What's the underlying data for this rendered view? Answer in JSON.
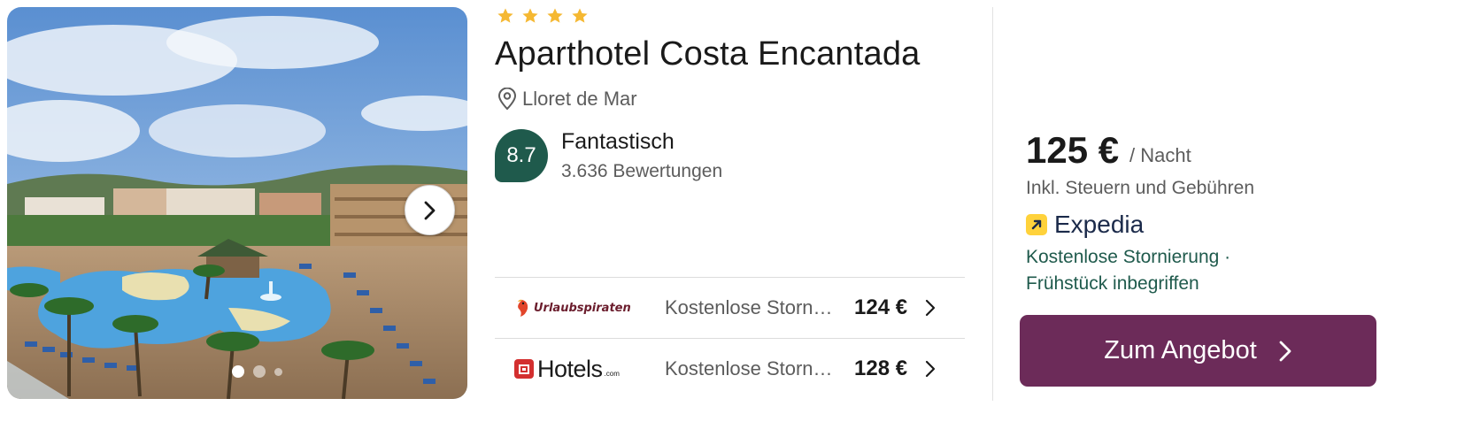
{
  "hotel": {
    "star_count": 4,
    "name": "Aparthotel Costa Encantada",
    "location": "Lloret de Mar",
    "rating": {
      "score": "8.7",
      "label": "Fantastisch",
      "reviews": "3.636 Bewertungen"
    }
  },
  "gallery": {
    "slide_count": 3,
    "active_slide": 1
  },
  "offers": [
    {
      "provider": "Urlaubspiraten",
      "cancellation": "Kostenlose Storn…",
      "price": "124 €"
    },
    {
      "provider": "Hotels",
      "provider_suffix": ".com",
      "cancellation": "Kostenlose Storn…",
      "price": "128 €"
    }
  ],
  "best_offer": {
    "price": "125 €",
    "unit": "/ Nacht",
    "note": "Inkl. Steuern und Gebühren",
    "provider": "Expedia",
    "perks_line1": "Kostenlose Stornierung ·",
    "perks_line2": "Frühstück inbegriffen",
    "cta_label": "Zum Angebot"
  },
  "colors": {
    "rating_badge": "#1f5a4c",
    "cta_background": "#6c2b59",
    "perks_text": "#1f5a4c",
    "star": "#f5b832",
    "expedia_icon": "#ffd23b"
  }
}
